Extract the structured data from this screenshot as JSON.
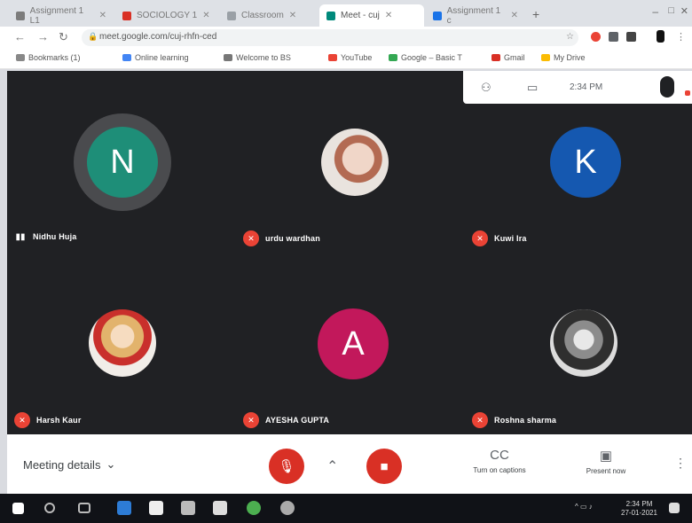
{
  "browser": {
    "tabs": [
      {
        "label": "Assignment 1 L1",
        "color": "#7c7c7c"
      },
      {
        "label": "SOCIOLOGY 1",
        "color": "#d93025"
      },
      {
        "label": "Classroom",
        "color": "#9aa0a6"
      },
      {
        "label": "Meet - cuj",
        "color": "#00897b"
      },
      {
        "label": "Assignment 1 c",
        "color": "#1a73e8"
      }
    ],
    "url": "meet.google.com/cuj-rhfn-ced",
    "bookmarks": [
      "Bookmarks (1)",
      "Online learning",
      "Welcome to BS",
      "YouTube",
      "Google – Basic T",
      "Gmail",
      "My Drive"
    ]
  },
  "meet": {
    "topbar": {
      "participants_icon": "people-icon",
      "chat_icon": "chat-icon",
      "time": "2:34 PM"
    },
    "participants": [
      {
        "initial": "N",
        "name": "Nidhu Huja",
        "color": "#1e8e78",
        "speaking": true
      },
      {
        "initial": "",
        "name": "urdu wardhan",
        "color": "#c8b8b0",
        "speaking": false
      },
      {
        "initial": "K",
        "name": "Kuwi Ira",
        "color": "#1558b0",
        "speaking": false
      },
      {
        "initial": "",
        "name": "Harsh Kaur",
        "color": "#d9b78a",
        "speaking": false
      },
      {
        "initial": "A",
        "name": "AYESHA GUPTA",
        "color": "#c2185b",
        "speaking": false
      },
      {
        "initial": "",
        "name": "Roshna sharma",
        "color": "#8a8a8a",
        "speaking": false
      }
    ]
  },
  "bottombar": {
    "meeting_details": "Meeting details",
    "turn_on_captions": "Turn on captions",
    "present_now": "Present now"
  },
  "taskbar": {
    "time": "2:34 PM",
    "date": "27-01-2021"
  }
}
